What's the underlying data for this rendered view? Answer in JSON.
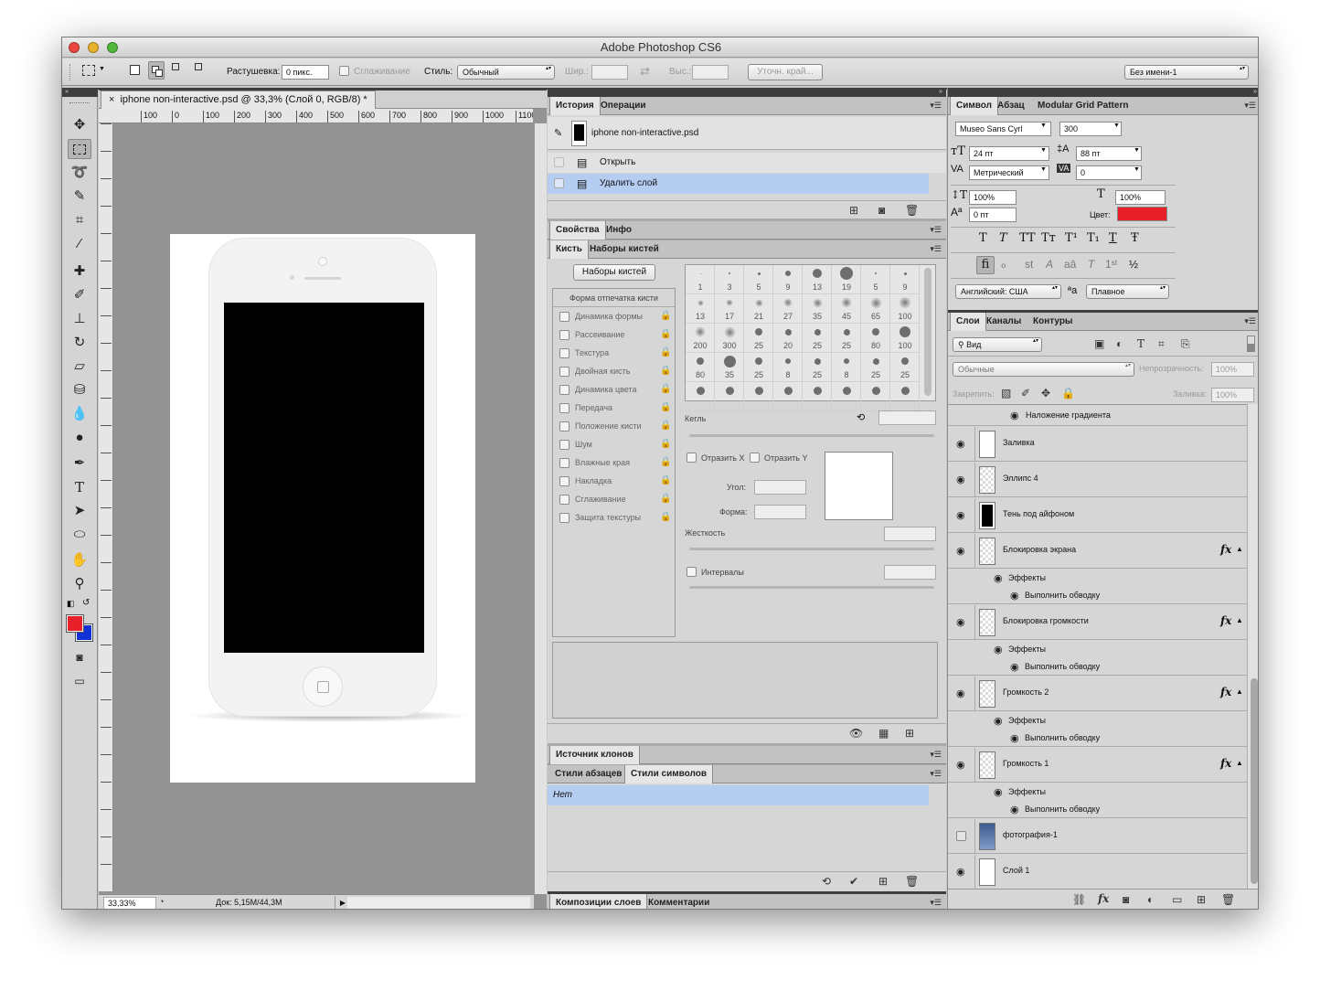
{
  "window": {
    "title": "Adobe Photoshop CS6"
  },
  "options": {
    "feather_label": "Растушевка:",
    "feather_value": "0 пикс.",
    "antialias_label": "Сглаживание",
    "style_label": "Стиль:",
    "style_value": "Обычный",
    "width_label": "Шир.:",
    "height_label": "Выс.:",
    "refine_edge": "Уточн. край...",
    "workspace": "Без имени-1"
  },
  "document": {
    "tab_title": "iphone non-interactive.psd @ 33,3% (Слой 0, RGB/8) *",
    "close": "×",
    "zoom": "33,33%",
    "doc_info": "Док: 5,15M/44,3M",
    "ruler_ticks": [
      "100",
      "0",
      "100",
      "200",
      "300",
      "400",
      "500",
      "600",
      "700",
      "800",
      "900",
      "1000",
      "1100"
    ]
  },
  "history_panel": {
    "tabs": [
      "История",
      "Операции"
    ],
    "snapshot": "iphone non-interactive.psd",
    "items": [
      "Открыть",
      "Удалить слой"
    ]
  },
  "properties_panel": {
    "tabs": [
      "Свойства",
      "Инфо"
    ]
  },
  "brush_panel": {
    "tabs": [
      "Кисть",
      "Наборы кистей"
    ],
    "presets_button": "Наборы кистей",
    "tip_shape": "Форма отпечатка кисти",
    "options": [
      "Динамика формы",
      "Рассеивание",
      "Текстура",
      "Двойная кисть",
      "Динамика цвета",
      "Передача",
      "Положение кисти",
      "Шум",
      "Влажные края",
      "Накладка",
      "Сглаживание",
      "Защита текстуры"
    ],
    "brush_sizes": [
      "1",
      "3",
      "5",
      "9",
      "13",
      "19",
      "5",
      "9",
      "13",
      "17",
      "21",
      "27",
      "35",
      "45",
      "65",
      "100",
      "200",
      "300",
      "25",
      "20",
      "25",
      "25",
      "80",
      "100",
      "80",
      "35",
      "25",
      "8",
      "25",
      "8",
      "25",
      "25"
    ],
    "size_label": "Кегль",
    "flip_x": "Отразить X",
    "flip_y": "Отразить Y",
    "angle_label": "Угол:",
    "roundness_label": "Форма:",
    "hardness_label": "Жесткость",
    "spacing_label": "Интервалы"
  },
  "clone_panel": {
    "title": "Источник клонов"
  },
  "styles_panel": {
    "tabs": [
      "Стили абзацев",
      "Стили символов"
    ],
    "item": "Нет"
  },
  "bottom_panel": {
    "tabs": [
      "Композиции слоев",
      "Комментарии"
    ]
  },
  "character_panel": {
    "tabs": [
      "Символ",
      "Абзац",
      "Modular Grid Pattern"
    ],
    "font": "Museo Sans Cyrl",
    "weight": "300",
    "size": "24 пт",
    "leading": "88 пт",
    "kerning": "Метрический",
    "tracking": "0",
    "vscale": "100%",
    "hscale": "100%",
    "baseline": "0 пт",
    "color_label": "Цвет:",
    "color": "#e8202a",
    "language": "Английский: США",
    "aa_label": "ªa",
    "antialias": "Плавное",
    "type_styles": [
      "T",
      "T",
      "TT",
      "Tт",
      "T¹",
      "T₁",
      "T",
      "Ŧ"
    ]
  },
  "layers_panel": {
    "tabs": [
      "Слои",
      "Каналы",
      "Контуры"
    ],
    "filter": "Вид",
    "blend": "Обычные",
    "opacity_label": "Непрозрачность:",
    "opacity": "100%",
    "lock_label": "Закрепить:",
    "fill_label": "Заливка:",
    "fill": "100%",
    "top_effect": "Наложение градиента",
    "layers": [
      {
        "name": "Заливка",
        "visible": true,
        "fx": false
      },
      {
        "name": "Эллипс 4",
        "visible": true,
        "fx": false
      },
      {
        "name": "Тень под айфоном",
        "visible": true,
        "fx": false
      },
      {
        "name": "Блокировка экрана",
        "visible": true,
        "fx": true,
        "effects": "Эффекты",
        "stroke": "Выполнить обводку"
      },
      {
        "name": "Блокировка громкости",
        "visible": true,
        "fx": true,
        "effects": "Эффекты",
        "stroke": "Выполнить обводку"
      },
      {
        "name": "Громкость 2",
        "visible": true,
        "fx": true,
        "effects": "Эффекты",
        "stroke": "Выполнить обводку"
      },
      {
        "name": "Громкость 1",
        "visible": true,
        "fx": true,
        "effects": "Эффекты",
        "stroke": "Выполнить обводку"
      },
      {
        "name": "фотография-1",
        "visible": false,
        "fx": false
      },
      {
        "name": "Слой 1",
        "visible": true,
        "fx": false
      }
    ],
    "fx_symbol": "fx"
  },
  "colors": {
    "foreground": "#e8202a",
    "background": "#1030d8",
    "selected_row": "#b6cdf2"
  }
}
